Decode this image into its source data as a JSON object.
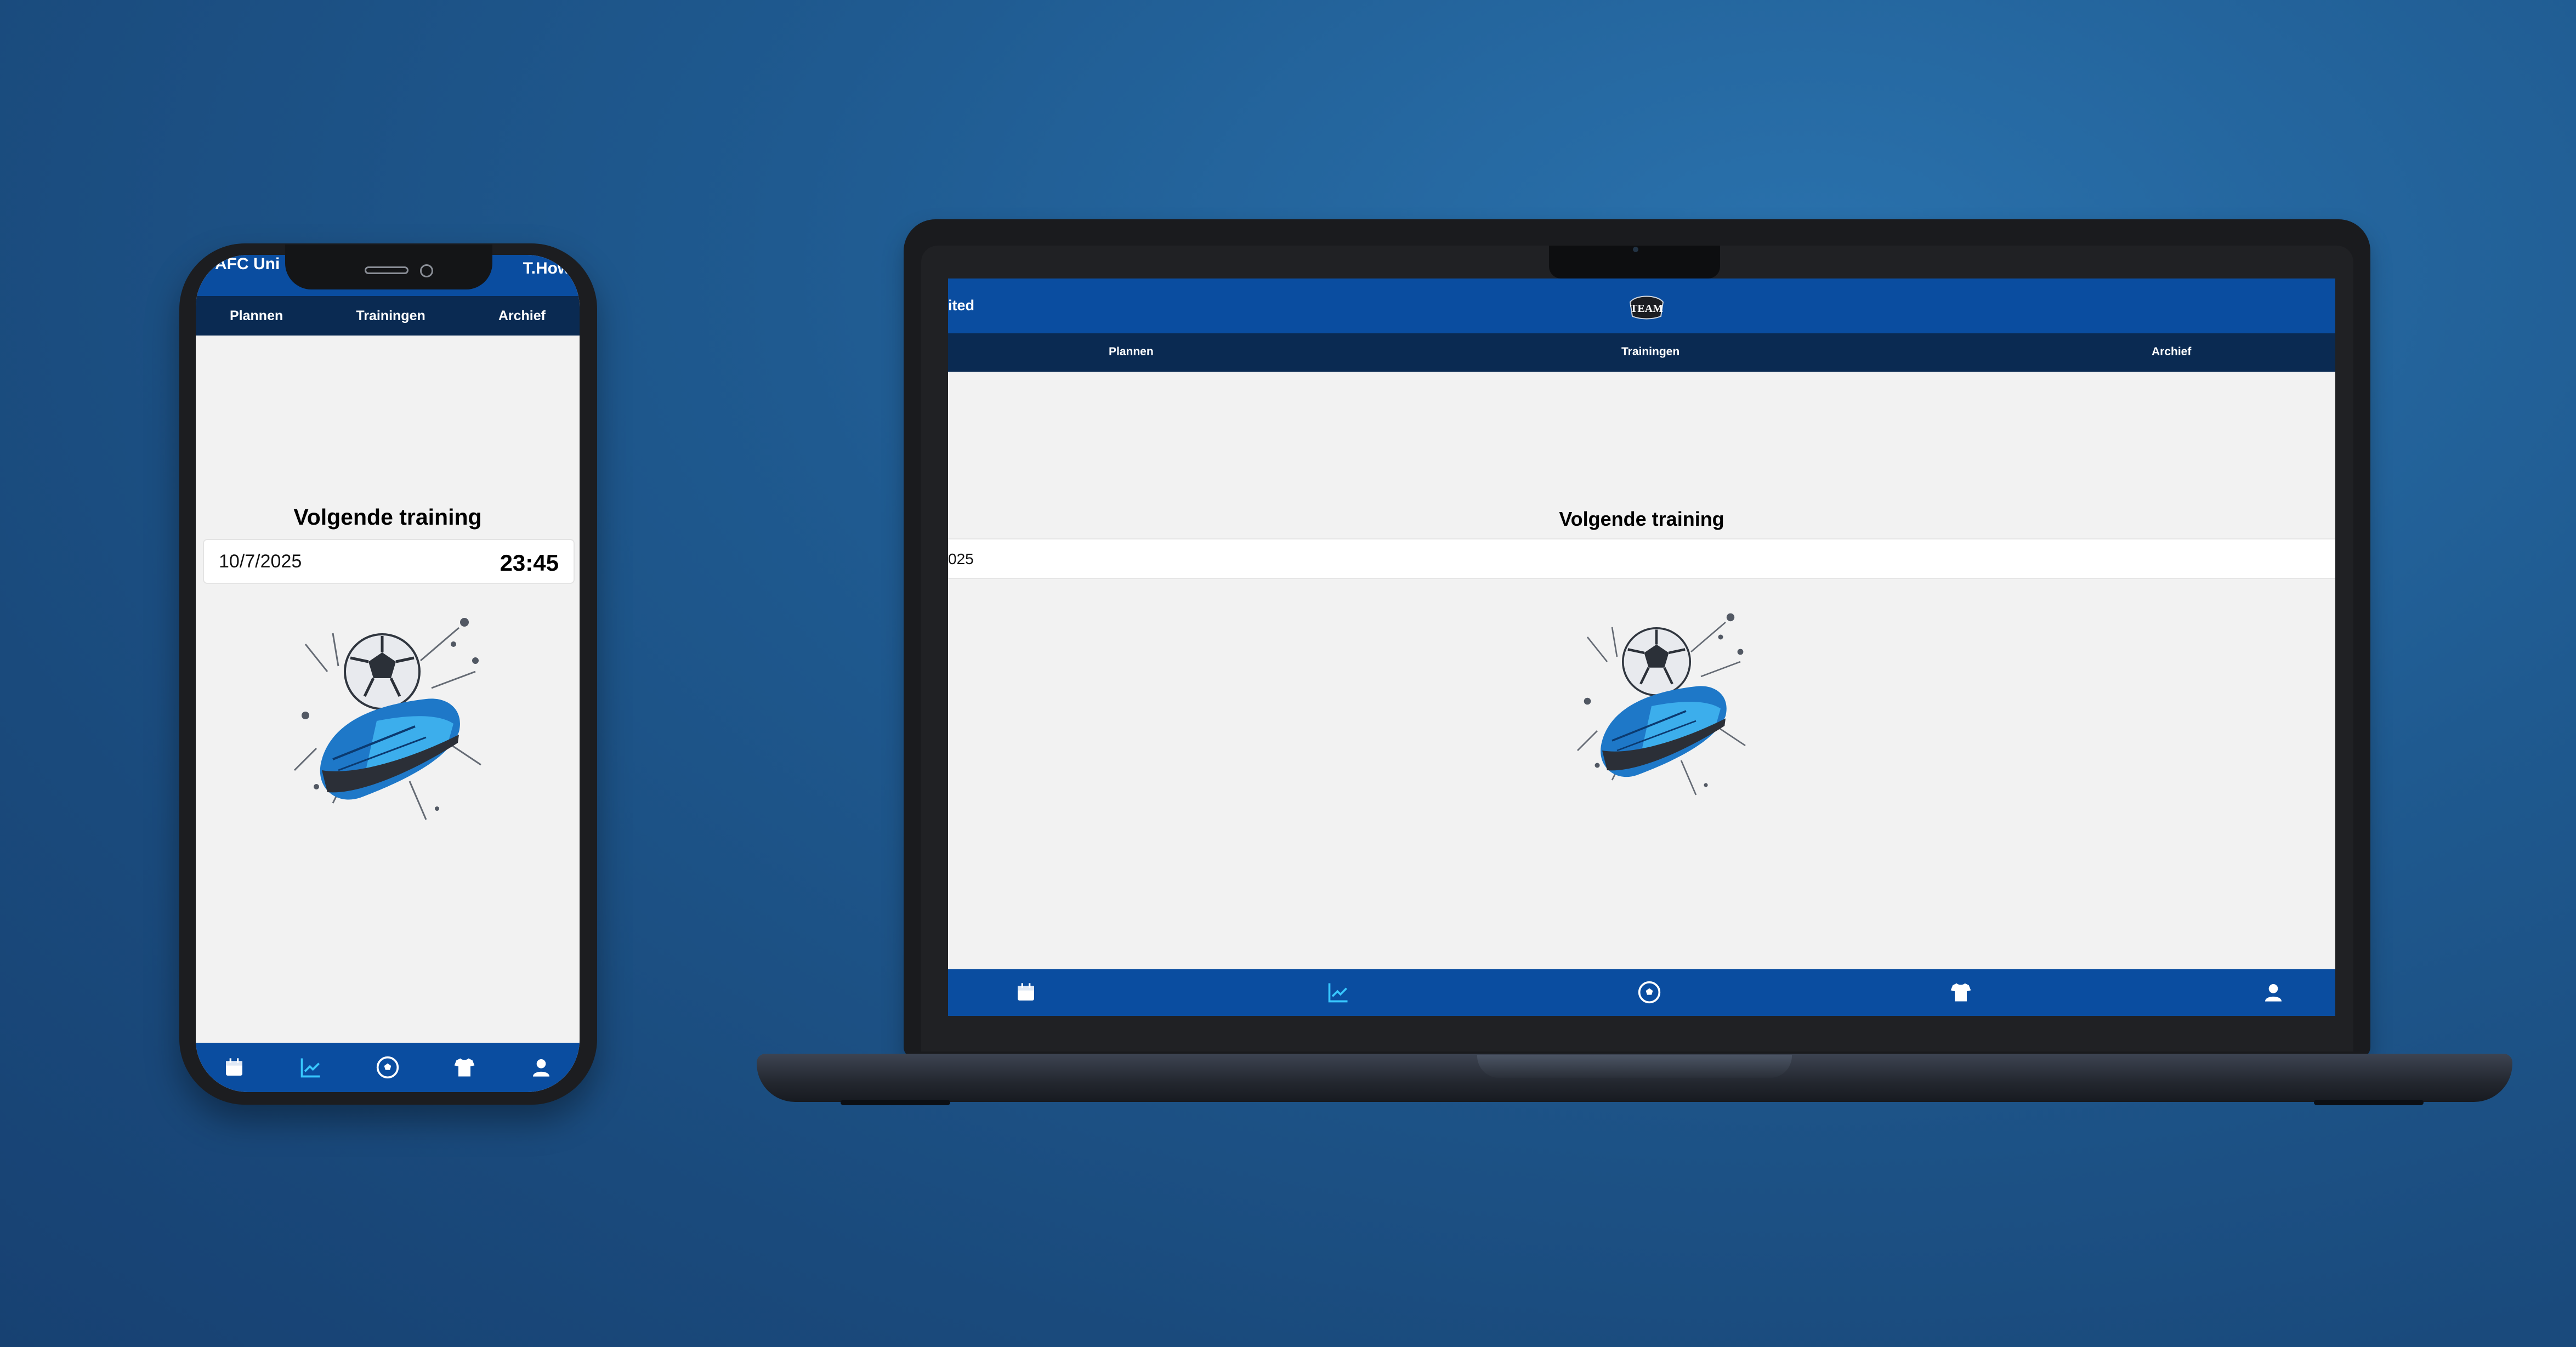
{
  "phone": {
    "team_name": "AFC Uni",
    "user_name": "T.Howa",
    "tabs": [
      "Plannen",
      "Trainingen",
      "Archief"
    ],
    "next_training_title": "Volgende training",
    "next_training_date": "10/7/2025",
    "next_training_time": "23:45",
    "nav_icons": [
      "calendar-icon",
      "chart-icon",
      "soccer-ball-icon",
      "shirt-icon",
      "user-icon"
    ]
  },
  "laptop": {
    "team_name": "ited",
    "logo_text": "TEAM",
    "tabs": [
      "Plannen",
      "Trainingen",
      "Archief"
    ],
    "next_training_title": "Volgende training",
    "next_training_date": "025",
    "nav_icons": [
      "calendar-icon",
      "chart-icon",
      "soccer-ball-icon",
      "shirt-icon",
      "user-icon"
    ]
  },
  "colors": {
    "primary": "#0a4da0",
    "tab_bar": "#0a2a52",
    "active_icon": "#38c8ff",
    "page_bg": "#f2f2f2"
  }
}
